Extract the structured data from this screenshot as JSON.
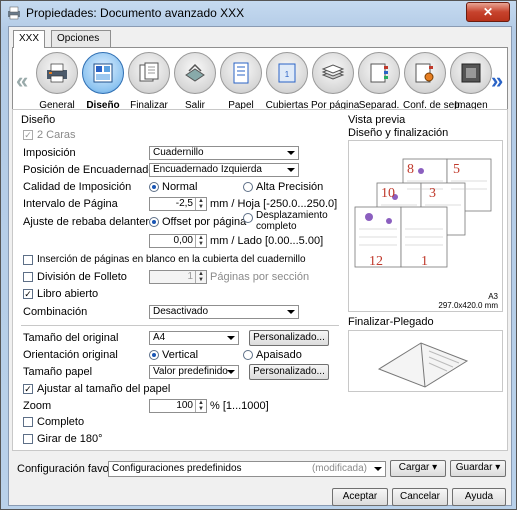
{
  "window": {
    "title": "Propiedades: Documento avanzado XXX",
    "close_label": "✕"
  },
  "tabs": [
    "XXX",
    "Opciones avanzadas"
  ],
  "ribbon": [
    {
      "label": "General",
      "icon": "printer-icon"
    },
    {
      "label": "Diseño",
      "icon": "layout-icon",
      "selected": true
    },
    {
      "label": "Finalizar",
      "icon": "finishing-icon"
    },
    {
      "label": "Salir",
      "icon": "output-tray-icon"
    },
    {
      "label": "Papel",
      "icon": "paper-icon"
    },
    {
      "label": "Cubiertas",
      "icon": "cover-icon"
    },
    {
      "label": "Por página",
      "icon": "per-page-stack-icon"
    },
    {
      "label": "Separad.",
      "icon": "separator-icon"
    },
    {
      "label": "Conf. de sep.",
      "icon": "separator-settings-icon"
    },
    {
      "label": "Imagen",
      "icon": "image-icon"
    }
  ],
  "layout": {
    "section_title": "Diseño",
    "dos_caras": "2 Caras",
    "imposicion": {
      "label": "Imposición",
      "value": "Cuadernillo"
    },
    "encuadernado": {
      "label": "Posición de Encuadernado",
      "value": "Encuadernado Izquierda"
    },
    "calidad": {
      "label": "Calidad de Imposición",
      "opt1": "Normal",
      "opt2": "Alta Precisión"
    },
    "intervalo": {
      "label": "Intervalo de Página",
      "value": "-2,5",
      "unit": "mm / Hoja [-250.0...250.0]"
    },
    "rebaba": {
      "label": "Ajuste de rebaba delantera",
      "opt1": "Offset por página",
      "opt2a": "Desplazamiento",
      "opt2b": "completo",
      "value": "0,00",
      "unit": "mm / Lado [0.00...5.00]"
    },
    "insercion": "Inserción de páginas en blanco en la cubierta del cuadernillo",
    "division": {
      "label": "División de Folleto",
      "value": "1",
      "unit": "Páginas por sección"
    },
    "libro": "Libro abierto",
    "combinacion": {
      "label": "Combinación",
      "value": "Desactivado"
    },
    "tam_original": {
      "label": "Tamaño del original",
      "value": "A4",
      "button": "Personalizado..."
    },
    "orientacion": {
      "label": "Orientación original",
      "opt1": "Vertical",
      "opt2": "Apaisado"
    },
    "tam_papel": {
      "label": "Tamaño papel",
      "value": "Valor predefinido",
      "button": "Personalizado..."
    },
    "ajustar": "Ajustar al tamaño del papel",
    "zoom": {
      "label": "Zoom",
      "value": "100",
      "unit": "% [1...1000]"
    },
    "completo": "Completo",
    "girar": "Girar de 180°"
  },
  "preview": {
    "title": "Vista previa",
    "subtitle": "Diseño y finalización",
    "size_label": "A3",
    "size_value": "297.0x420.0 mm",
    "fold_title": "Finalizar-Plegado",
    "page_numbers": [
      "8",
      "5",
      "10",
      "3",
      "12",
      "1"
    ]
  },
  "footer": {
    "label": "Configuración favorita",
    "value": "Configuraciones predefinidos",
    "modified": "(modificada)",
    "load": "Cargar",
    "save": "Guardar",
    "accept": "Aceptar",
    "cancel": "Cancelar",
    "help": "Ayuda"
  },
  "colors": {
    "accent": "#2a63c6",
    "page_number": "#c0392b"
  }
}
